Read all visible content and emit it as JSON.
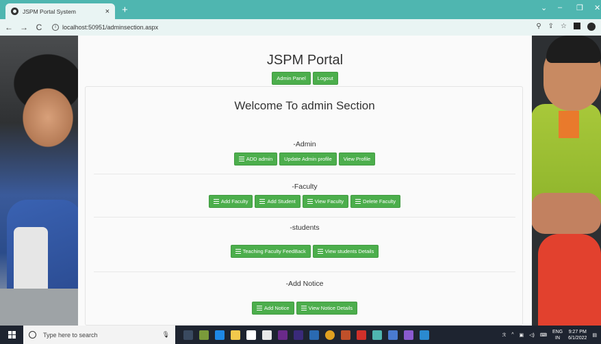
{
  "browser": {
    "tab_title": "JSPM Portal System",
    "tab_close": "×",
    "new_tab": "+",
    "url": "localhost:50951/adminsection.aspx",
    "back": "←",
    "forward": "→",
    "reload": "C"
  },
  "page": {
    "site_title": "JSPM Portal",
    "top_buttons": {
      "admin_panel": "Admin Panel",
      "logout": "Logout"
    },
    "welcome": "Welcome To admin Section",
    "sections": {
      "admin": {
        "label": "-Admin",
        "buttons": {
          "add_admin": "ADD admin",
          "update_profile": "Update Admin profile",
          "view_profile": "View Profile"
        }
      },
      "faculty": {
        "label": "-Faculty",
        "buttons": {
          "add_faculty": "Add Faculty",
          "add_student": "Add Student",
          "view_faculty": "View Faculty",
          "delete_faculty": "Delete Faculty"
        }
      },
      "students": {
        "label": "-students",
        "buttons": {
          "feedback": "Teaching Faculty FeedBack",
          "view_students": "View students Details"
        }
      },
      "notice": {
        "label": "-Add Notice",
        "buttons": {
          "add_notice": "Add Notice",
          "view_notice": "View Notice Details"
        }
      }
    },
    "accent_color": "#4cae4c"
  },
  "taskbar": {
    "search_placeholder": "Type here to search",
    "lang_top": "ENG",
    "lang_bottom": "IN",
    "time": "9:27 PM",
    "date": "6/1/2022"
  }
}
